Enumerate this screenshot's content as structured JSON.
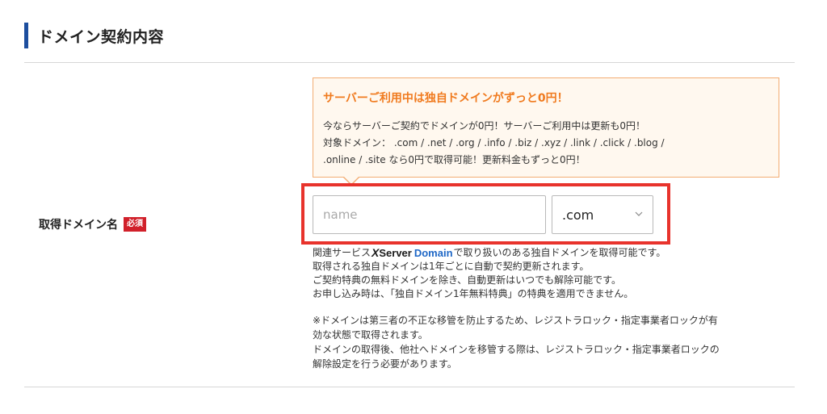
{
  "section": {
    "title": "ドメイン契約内容"
  },
  "field": {
    "label": "取得ドメイン名",
    "required_badge": "必須"
  },
  "notice": {
    "title": "サーバーご利用中は独自ドメインがずっと0円！",
    "line1": "今ならサーバーご契約でドメインが0円！サーバーご利用中は更新も0円！",
    "line2": "対象ドメイン：  .com / .net / .org / .info / .biz / .xyz / .link / .click / .blog /",
    "line3": ".online / .site なら0円で取得可能！更新料金もずっと0円！"
  },
  "domain_input": {
    "value": "",
    "placeholder": "name"
  },
  "tld_select": {
    "selected": ".com"
  },
  "info": {
    "line1_prefix": "関連サービス",
    "brand_x": "X",
    "brand_server": "Server",
    "brand_domain": "Domain",
    "line1_suffix": "で取り扱いのある独自ドメインを取得可能です。",
    "line2": "取得される独自ドメインは1年ごとに自動で契約更新されます。",
    "line3": "ご契約特典の無料ドメインを除き、自動更新はいつでも解除可能です。",
    "line4": "お申し込み時は、「独自ドメイン1年無料特典」の特典を適用できません。"
  },
  "note": {
    "line1": "※ドメインは第三者の不正な移管を防止するため、レジストラロック・指定事業者ロックが有",
    "line2": "効な状態で取得されます。",
    "line3": "ドメインの取得後、他社へドメインを移管する際は、レジストラロック・指定事業者ロックの",
    "line4": "解除設定を行う必要があります。"
  },
  "colors": {
    "header_bar": "#1d4e9e",
    "notice_title": "#f07a1e",
    "notice_border": "#f3ad73",
    "notice_bg": "#fff8ef",
    "required_badge": "#d1202a",
    "highlight": "#e8332c",
    "brand_domain": "#1e67c6"
  },
  "icons": {
    "select_arrow": "chevron-down-icon"
  }
}
